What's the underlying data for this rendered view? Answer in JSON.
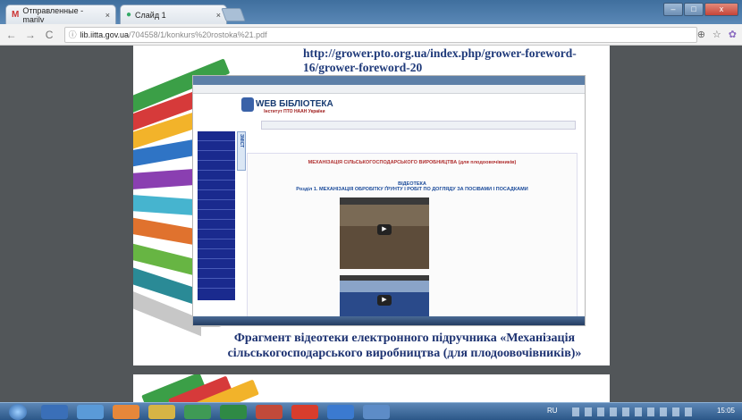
{
  "browser": {
    "tabs": [
      {
        "label": "Отправленные - marilv",
        "icon": "gmail-icon"
      },
      {
        "label": "Слайд 1",
        "icon": "person-icon"
      }
    ],
    "close_glyph": "×",
    "url_host": "lib.iitta.gov.ua",
    "url_path": "/704558/1/konkurs%20rostoka%21.pdf",
    "window_buttons": [
      "–",
      "□",
      "x"
    ]
  },
  "slide": {
    "link_text": "http://grower.pto.org.ua/index.php/grower-foreword-16/grower-foreword-20",
    "caption": "Фрагмент відеотеки електронного підручника «Механізація сільськогосподарського виробництва (для плодоовочівників)»",
    "embedded_site": {
      "brand": "WEB БІБЛІОТЕКА",
      "brand_sub": "Інститут ПТО НААН України",
      "tab_label": "ЗМІСТ",
      "heading": "МЕХАНІЗАЦІЯ СІЛЬСЬКОГОСПОДАРСЬКОГО ВИРОБНИЦТВА (для плодоовочівників)",
      "section_title": "ВІДЕОТЕКА",
      "section_sub": "Розділ 1. МЕХАНІЗАЦІЯ ОБРОБІТКУ ҐРУНТУ І РОБІТ ПО ДОГЛЯДУ ЗА ПОСІВАМИ І ПОСАДКАМИ"
    }
  },
  "taskbar": {
    "time": "15:05",
    "lang": "RU"
  },
  "colors": {
    "tabbar": "#4a7aa8",
    "slide_blue": "#1e3372",
    "sidebar": "#1a2a8e"
  }
}
